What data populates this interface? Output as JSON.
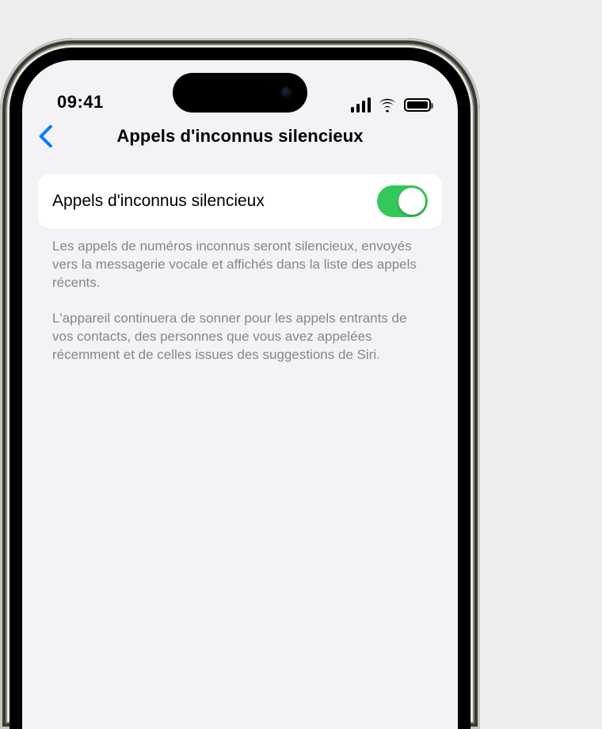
{
  "status": {
    "time": "09:41"
  },
  "nav": {
    "title": "Appels d'inconnus silencieux"
  },
  "setting": {
    "toggle_label": "Appels d'inconnus silencieux",
    "toggle_state": "on"
  },
  "footer": {
    "p1": "Les appels de numéros inconnus seront silencieux, envoyés vers la messagerie vocale et affichés dans la liste des appels récents.",
    "p2": "L'appareil continuera de sonner pour les appels entrants de vos contacts, des personnes que vous avez appelées récemment et de celles issues des suggestions de Siri."
  }
}
